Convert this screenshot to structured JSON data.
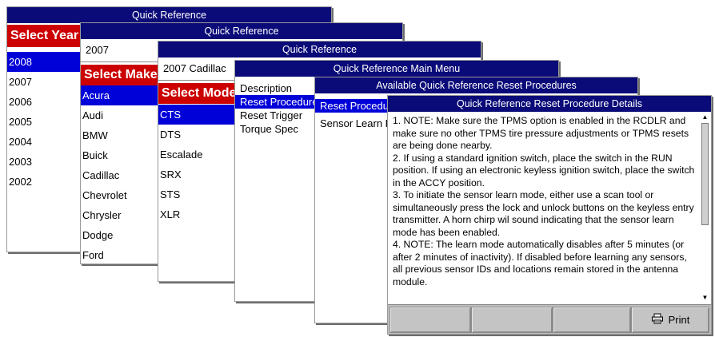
{
  "colors": {
    "title_bar": "#0a0a78",
    "red_header": "#cc0000",
    "selection": "#0000d8",
    "button_bar": "#bdbdbd"
  },
  "w1": {
    "title": "Quick Reference",
    "header": "Select Year",
    "years": [
      "2008",
      "2007",
      "2006",
      "2005",
      "2004",
      "2003",
      "2002"
    ],
    "selected": "2008"
  },
  "w2": {
    "title": "Quick Reference",
    "field": "2007",
    "header": "Select Make",
    "makes": [
      "Acura",
      "Audi",
      "BMW",
      "Buick",
      "Cadillac",
      "Chevrolet",
      "Chrysler",
      "Dodge",
      "Ford"
    ],
    "selected": "Acura"
  },
  "w3": {
    "title": "Quick Reference",
    "field": "2007 Cadillac",
    "header": "Select Model",
    "models": [
      "CTS",
      "DTS",
      "Escalade",
      "SRX",
      "STS",
      "XLR"
    ],
    "selected": "CTS"
  },
  "w4": {
    "title": "Quick Reference Main Menu",
    "items": [
      "Description",
      "Reset Procedures",
      "Reset Trigger",
      "Torque  Spec"
    ],
    "selected": "Reset Procedures"
  },
  "w5": {
    "title": "Available Quick Reference Reset Procedures",
    "items": [
      "Reset Procedure",
      "Sensor Learn Procedure"
    ],
    "selected": "Reset Procedure"
  },
  "w6": {
    "title": "Quick Reference Reset Procedure Details",
    "paragraphs": [
      "1. NOTE: Make sure the TPMS option is enabled in the RCDLR and make sure no other TPMS tire pressure adjustments or TPMS resets are being done nearby.",
      "2. If using a standard ignition switch, place the switch in the RUN position. If using an electronic keyless ignition switch, place the switch in the ACCY position.",
      "3. To initiate the sensor learn mode, either use a scan tool or simultaneously press the lock and unlock buttons on the keyless entry transmitter. A horn chirp wil sound indicating that the sensor learn mode has been enabled.",
      "4. NOTE: The learn mode automatically disables after 5 minutes (or after 2 minutes of inactivity). If disabled before learning any sensors, all previous sensor IDs and locations remain stored in the antenna module."
    ],
    "print_label": "Print",
    "print_icon": "printer-icon"
  }
}
